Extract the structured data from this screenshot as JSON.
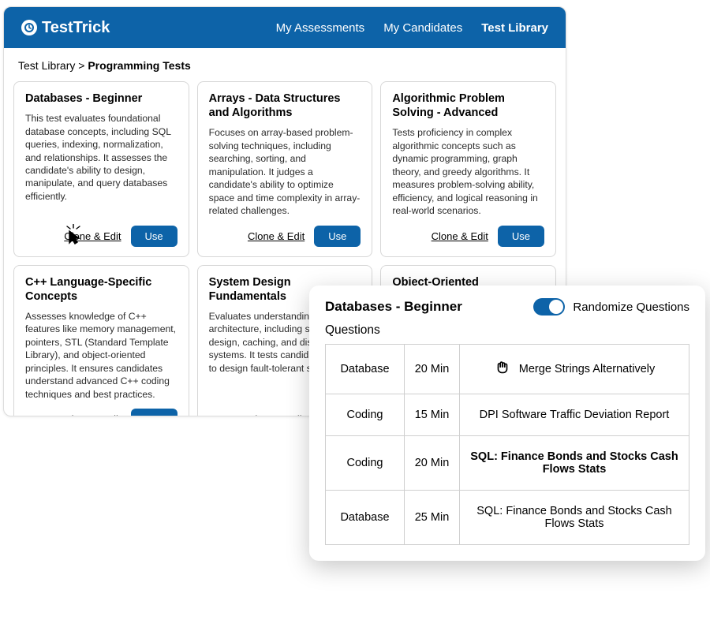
{
  "header": {
    "brand": "TestTrick",
    "nav": [
      {
        "label": "My Assessments",
        "active": false
      },
      {
        "label": "My Candidates",
        "active": false
      },
      {
        "label": "Test Library",
        "active": true
      }
    ]
  },
  "breadcrumb": {
    "root": "Test Library",
    "sep": ">",
    "current": "Programming Tests"
  },
  "actions": {
    "clone": "Clone & Edit",
    "use": "Use"
  },
  "cards": [
    {
      "title": "Databases - Beginner",
      "desc": "This test evaluates foundational database concepts, including SQL queries, indexing, normalization, and relationships. It assesses the candidate's ability to design, manipulate, and query databases efficiently."
    },
    {
      "title": "Arrays - Data Structures and Algorithms",
      "desc": "Focuses on array-based problem-solving techniques, including searching, sorting, and manipulation. It judges a candidate's ability to optimize space and time complexity in array-related challenges."
    },
    {
      "title": "Algorithmic Problem Solving - Advanced",
      "desc": "Tests proficiency in complex algorithmic concepts such as dynamic programming, graph theory, and greedy algorithms. It measures problem-solving ability, efficiency, and logical reasoning in real-world scenarios."
    },
    {
      "title": "C++ Language-Specific Concepts",
      "desc": "Assesses knowledge of C++ features like memory management, pointers, STL (Standard Template Library), and object-oriented principles. It ensures candidates understand advanced C++ coding techniques and best practices."
    },
    {
      "title": "System Design Fundamentals",
      "desc": "Evaluates understanding of system architecture, including scaling, API design, caching, and distributed systems. It tests candidates' ability to design fault-tolerant systems."
    },
    {
      "title": "Object-Oriented Programming",
      "desc": ""
    }
  ],
  "panel": {
    "title": "Databases - Beginner",
    "toggle_label": "Randomize Questions",
    "toggle_on": true,
    "questions_label": "Questions",
    "questions": [
      {
        "category": "Database",
        "duration": "20 Min",
        "name": "Merge Strings Alternatively",
        "grab": true,
        "bold": false
      },
      {
        "category": "Coding",
        "duration": "15 Min",
        "name": "DPI Software Traffic Deviation Report",
        "grab": false,
        "bold": false
      },
      {
        "category": "Coding",
        "duration": "20 Min",
        "name": "SQL: Finance Bonds and Stocks Cash Flows Stats",
        "grab": false,
        "bold": true
      },
      {
        "category": "Database",
        "duration": "25 Min",
        "name": "SQL: Finance Bonds and Stocks Cash Flows Stats",
        "grab": false,
        "bold": false
      }
    ]
  }
}
